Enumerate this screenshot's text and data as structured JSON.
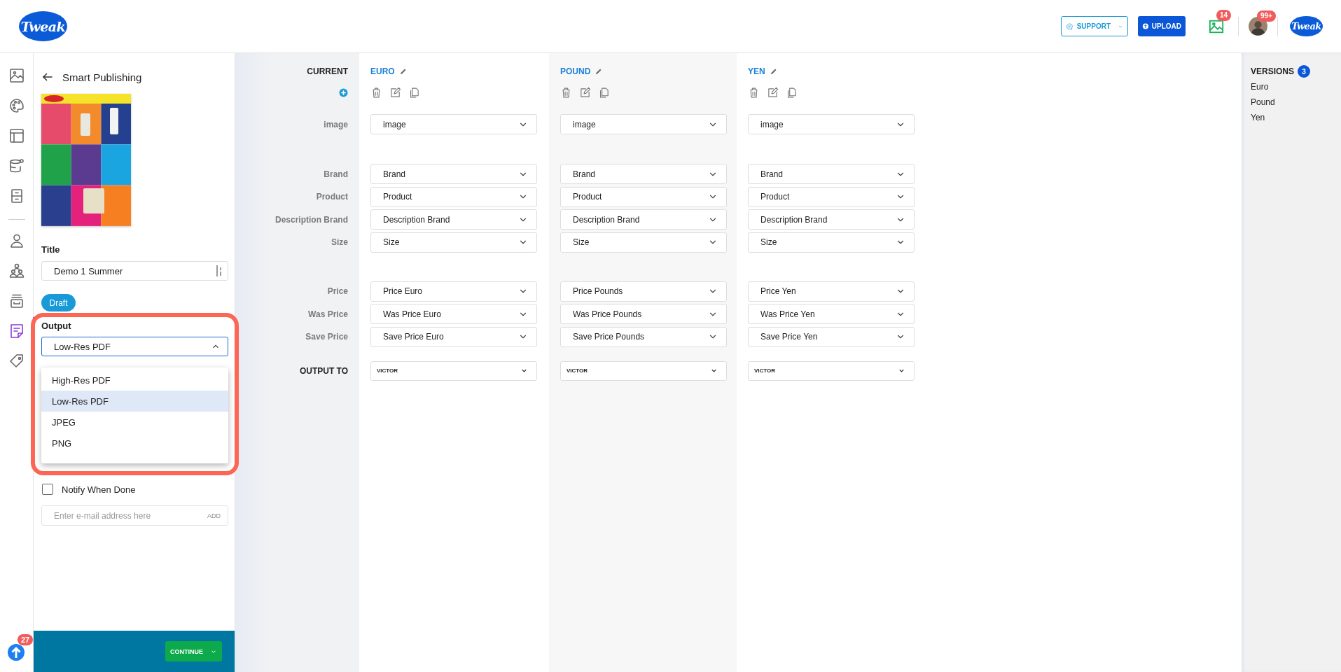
{
  "header": {
    "logo": "Tweak",
    "support": "SUPPORT",
    "upload": "UPLOAD",
    "notifications_badge": "14",
    "profile_badge": "99+",
    "brand_logo": "Tweak"
  },
  "nav_rail": {
    "groups": [
      {
        "items": [
          {
            "selected": false
          },
          {
            "selected": false
          },
          {
            "selected": false
          },
          {
            "selected": false
          },
          {
            "selected": false
          }
        ]
      },
      {
        "items": [
          {
            "selected": false
          },
          {
            "selected": false
          },
          {
            "selected": false
          },
          {
            "selected": true
          },
          {
            "selected": false
          }
        ]
      }
    ],
    "upload_badge": "27"
  },
  "panel": {
    "title": "Smart Publishing",
    "title_label": "Title",
    "title_value": "Demo 1 Summer",
    "status": "Draft",
    "output_label": "Output",
    "output_value": "Low-Res PDF",
    "output_options": [
      {
        "label": "High-Res PDF",
        "selected": false
      },
      {
        "label": "Low-Res PDF",
        "selected": true
      },
      {
        "label": "JPEG",
        "selected": false
      },
      {
        "label": "PNG",
        "selected": false
      }
    ],
    "notify": {
      "label": "Notify When Done",
      "checked": false
    },
    "email": {
      "placeholder": "Enter e-mail address here",
      "add": "ADD"
    },
    "continue": "CONTINUE"
  },
  "mapping": {
    "current_label": "CURRENT",
    "output_to_label": "OUTPUT TO",
    "sections": [
      [
        "image"
      ],
      [
        "Brand",
        "Product",
        "Description Brand",
        "Size"
      ],
      [
        "Price",
        "Was Price",
        "Save Price"
      ]
    ],
    "versions": [
      {
        "name": "EURO",
        "sections": [
          [
            "image"
          ],
          [
            "Brand",
            "Product",
            "Description Brand",
            "Size"
          ],
          [
            "Price Euro",
            "Was Price Euro",
            "Save Price Euro"
          ]
        ],
        "output_to": "VICTOR"
      },
      {
        "name": "POUND",
        "sections": [
          [
            "image"
          ],
          [
            "Brand",
            "Product",
            "Description Brand",
            "Size"
          ],
          [
            "Price Pounds",
            "Was Price Pounds",
            "Save Price Pounds"
          ]
        ],
        "output_to": "VICTOR"
      },
      {
        "name": "YEN",
        "sections": [
          [
            "image"
          ],
          [
            "Brand",
            "Product",
            "Description Brand",
            "Size"
          ],
          [
            "Price Yen",
            "Was Price Yen",
            "Save Price Yen"
          ]
        ],
        "output_to": "VICTOR"
      }
    ]
  },
  "versions_panel": {
    "title": "VERSIONS",
    "count": "3",
    "items": [
      "Euro",
      "Pound",
      "Yen"
    ]
  }
}
